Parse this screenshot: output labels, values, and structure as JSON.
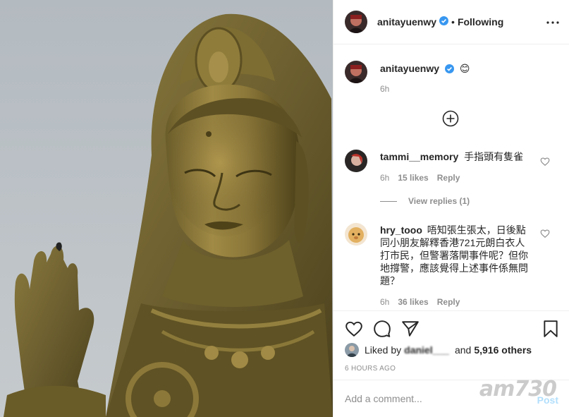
{
  "post": {
    "image_alt": "Golden Guanyin statue with a bird perched on its raised hand",
    "author": {
      "username": "anitayuenwy",
      "verified": true,
      "follow_status": "Following",
      "dot": "•"
    },
    "caption": {
      "username": "anitayuenwy",
      "emoji": "😊",
      "time": "6h"
    },
    "load_more_icon": "plus-circle-icon",
    "comments": [
      {
        "username": "tammi__memory",
        "text": "手指頭有隻雀",
        "time": "6h",
        "likes": "15 likes",
        "reply": "Reply",
        "view_replies": "View replies (1)"
      },
      {
        "username": "hry_tooo",
        "text_lines": [
          "唔知張生張太，日後點",
          "同小朋友解釋香港721元朗白衣人",
          "打市民，但警署落閘事件呢？但你",
          "地撐警，應該覺得上述事件係無問",
          "題？"
        ],
        "time": "6h",
        "likes": "36 likes",
        "reply": "Reply"
      }
    ],
    "likes": {
      "prefix": "Liked by",
      "user": "daniel___",
      "connector": "and",
      "others": "5,916 others"
    },
    "time_ago": "6 HOURS AGO",
    "add_comment": {
      "placeholder": "Add a comment...",
      "post_label": "Post"
    },
    "watermark": "am730",
    "colors": {
      "verified": "#3897f0",
      "muted": "#8e8e8e",
      "post_disabled": "#b2dffc",
      "border": "#efefef"
    }
  }
}
